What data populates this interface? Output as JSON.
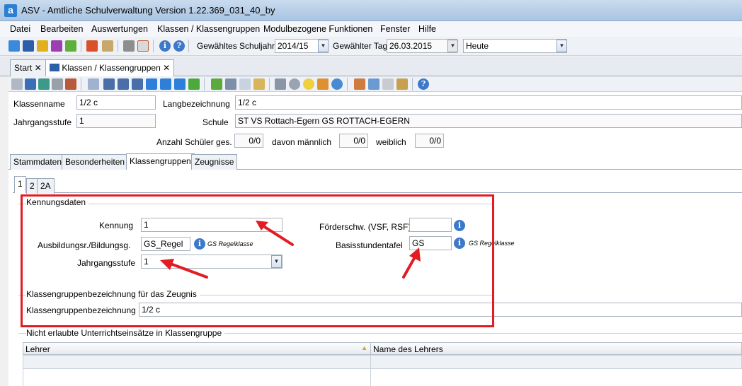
{
  "window": {
    "app_icon": "a",
    "title": "ASV - Amtliche Schulverwaltung Version 1.22.369_031_40_by"
  },
  "menu": [
    "Datei",
    "Bearbeiten",
    "Auswertungen",
    "Klassen / Klassengruppen",
    "Modulbezogene Funktionen",
    "Fenster",
    "Hilfe"
  ],
  "toolbar": {
    "schuljahr_label": "Gewähltes Schuljahr",
    "schuljahr_value": "2014/15",
    "tag_label": "Gewählter Tag",
    "tag_value": "26.03.2015",
    "heute_value": "Heute"
  },
  "doc_tabs": [
    {
      "label": "Start",
      "close": "✕"
    },
    {
      "label": "Klassen / Klassengruppen",
      "close": "✕"
    }
  ],
  "header": {
    "klassenname_label": "Klassenname",
    "klassenname_value": "1/2 c",
    "langbezeichnung_label": "Langbezeichnung",
    "langbezeichnung_value": "1/2 c",
    "jahrgangsstufe_label": "Jahrgangsstufe",
    "jahrgangsstufe_value": "1",
    "schule_label": "Schule",
    "schule_value": "ST VS Rottach-Egern GS ROTTACH-EGERN",
    "anzahl_label": "Anzahl Schüler ges.",
    "anzahl_value": "0/0",
    "maennlich_label": "davon männlich",
    "maennlich_value": "0/0",
    "weiblich_label": "weiblich",
    "weiblich_value": "0/0"
  },
  "main_tabs": [
    "Stammdaten",
    "Besonderheiten",
    "Klassengruppen",
    "Zeugnisse"
  ],
  "group_tabs": [
    "1",
    "2",
    "2A"
  ],
  "kennungsdaten": {
    "title": "Kennungsdaten",
    "kennung_label": "Kennung",
    "kennung_value": "1",
    "ausbildung_label": "Ausbildungsr./Bildungsg.",
    "ausbildung_value": "GS_Regel",
    "ausbildung_hint": "GS Regelklasse",
    "jahrgangsstufe_label": "Jahrgangsstufe",
    "jahrgangsstufe_value": "1",
    "foerder_label": "Förderschw. (VSF, RSF)",
    "foerder_value": "",
    "basis_label": "Basisstundentafel",
    "basis_value": "GS",
    "basis_hint": "GS Regelklasse"
  },
  "zeugnis": {
    "title": "Klassengruppenbezeichnung für das Zeugnis",
    "label": "Klassengruppenbezeichnung",
    "value": "1/2 c"
  },
  "einsaetze": {
    "title": "Nicht erlaubte Unterrichtseinsätze in Klassengruppe",
    "col_lehrer": "Lehrer",
    "col_name": "Name des Lehrers"
  },
  "colors": {
    "highlight_box": "#e31b23",
    "arrow": "#e31b23",
    "info_icon": "#3d79c9"
  }
}
